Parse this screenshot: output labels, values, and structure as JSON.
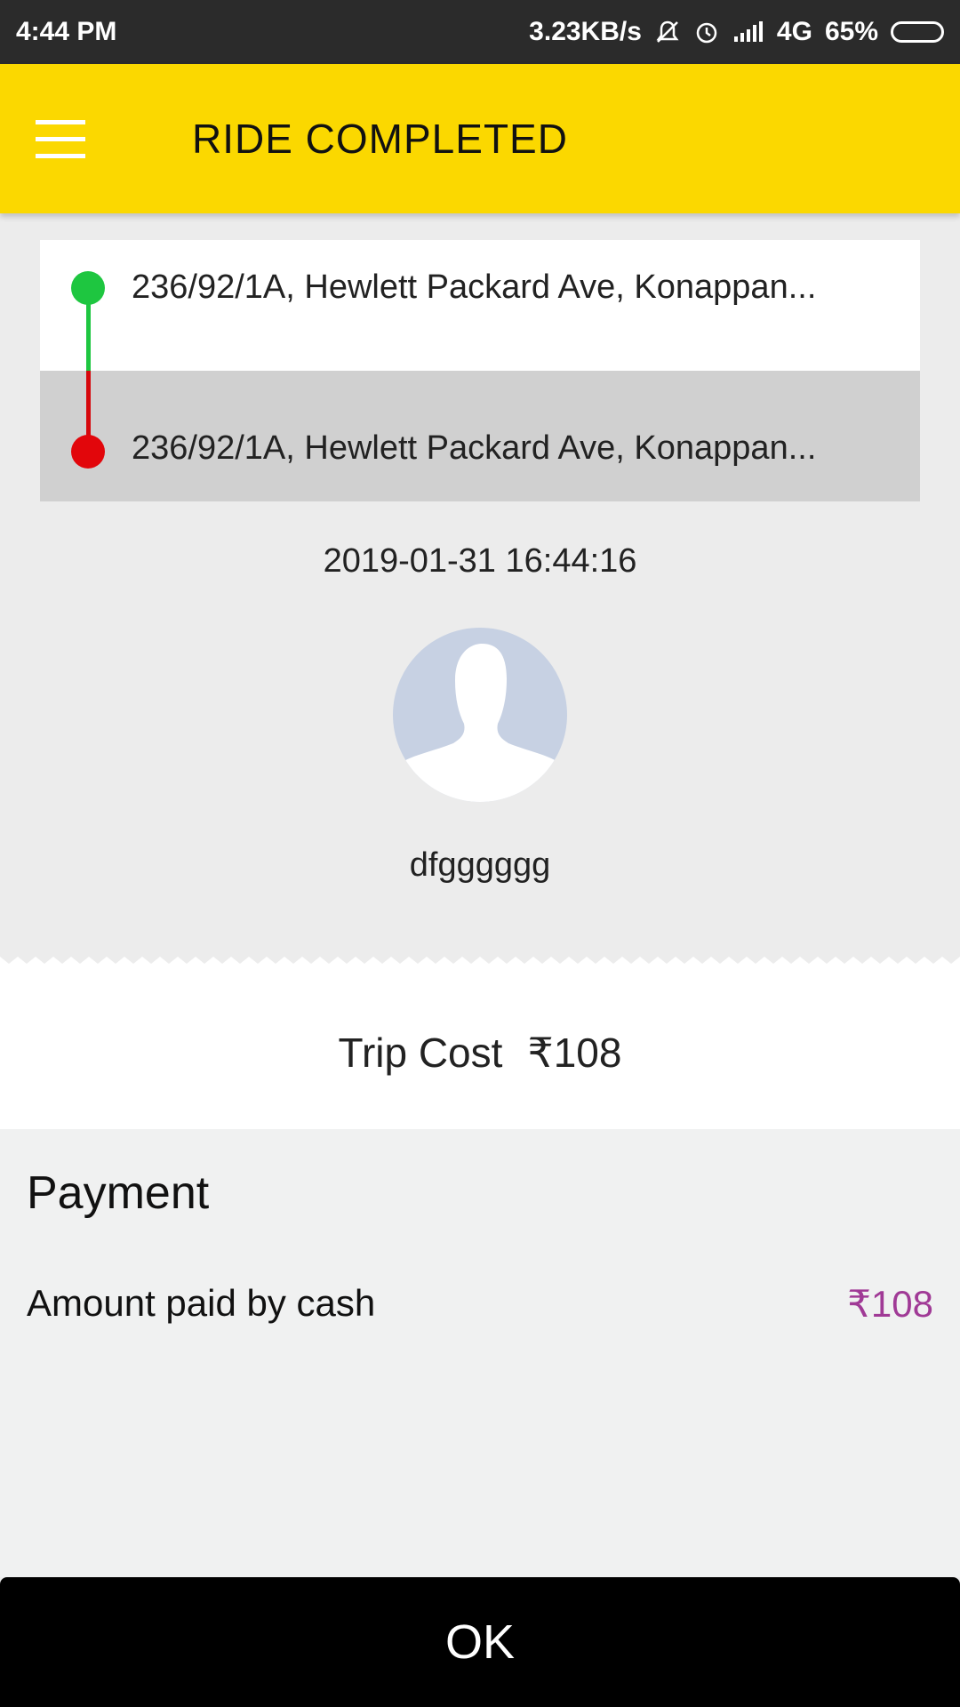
{
  "status_bar": {
    "time": "4:44 PM",
    "network_speed": "3.23KB/s",
    "network_type": "4G",
    "battery": "65%",
    "battery_level": 0.65,
    "icons": [
      "mute-icon",
      "alarm-icon",
      "signal-icon",
      "battery-icon"
    ]
  },
  "app_bar": {
    "title": "RIDE COMPLETED",
    "background_color": "#fbd800"
  },
  "route": {
    "pickup": "236/92/1A, Hewlett Packard Ave, Konappan...",
    "drop": "236/92/1A, Hewlett Packard Ave, Konappan...",
    "pickup_color": "#1ec640",
    "drop_color": "#e2060b"
  },
  "ride": {
    "datetime": "2019-01-31 16:44:16",
    "rider_name": "dfgggggg"
  },
  "trip_cost": {
    "label": "Trip Cost",
    "amount": "₹108"
  },
  "payment": {
    "title": "Payment",
    "method_label": "Amount paid by cash",
    "amount": "₹108",
    "amount_color": "#a03a96"
  },
  "actions": {
    "ok_label": "OK"
  }
}
